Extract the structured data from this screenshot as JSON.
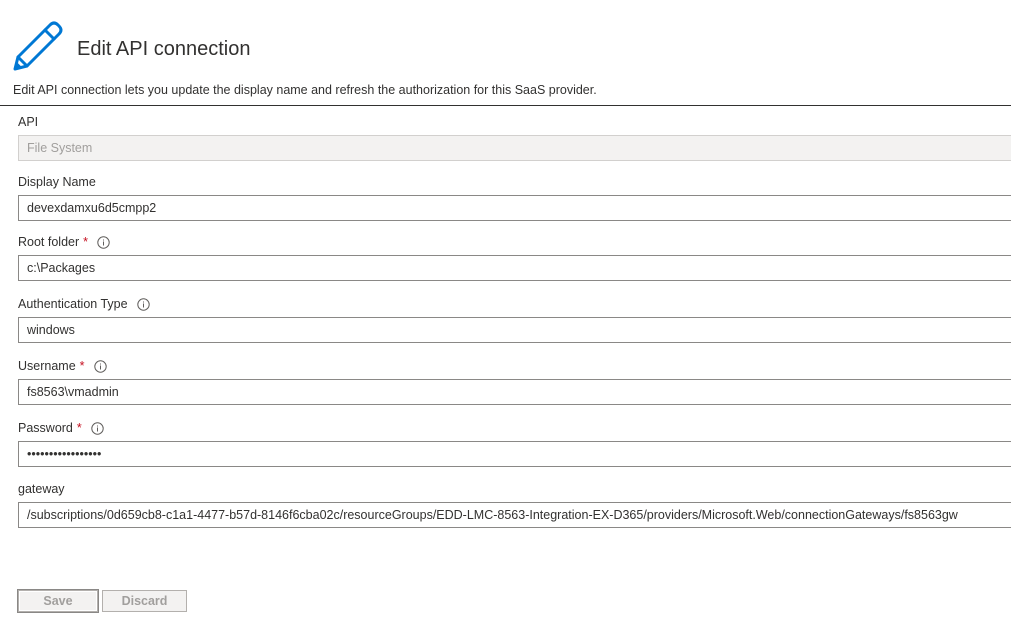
{
  "header": {
    "title": "Edit API connection",
    "description": "Edit API connection lets you update the display name and refresh the authorization for this SaaS provider."
  },
  "form": {
    "api": {
      "label": "API",
      "value": "File System"
    },
    "display_name": {
      "label": "Display Name",
      "value": "devexdamxu6d5cmpp2"
    },
    "root_folder": {
      "label": "Root folder",
      "required_mark": "*",
      "value": "c:\\Packages"
    },
    "authentication_type": {
      "label": "Authentication Type",
      "value": "windows"
    },
    "username": {
      "label": "Username",
      "required_mark": "*",
      "value": "fs8563\\vmadmin"
    },
    "password": {
      "label": "Password",
      "required_mark": "*",
      "value": "•••••••••••••••••"
    },
    "gateway": {
      "label": "gateway",
      "value": "/subscriptions/0d659cb8-c1a1-4477-b57d-8146f6cba02c/resourceGroups/EDD-LMC-8563-Integration-EX-D365/providers/Microsoft.Web/connectionGateways/fs8563gw"
    }
  },
  "buttons": {
    "save_label": "Save",
    "discard_label": "Discard"
  },
  "colors": {
    "accent": "#0078d4",
    "required": "#c50f1f",
    "text": "#323130",
    "border": "#8a8886",
    "disabled_bg": "#f3f2f1"
  },
  "icons": {
    "header": "pencil-icon",
    "info": "info-icon"
  }
}
